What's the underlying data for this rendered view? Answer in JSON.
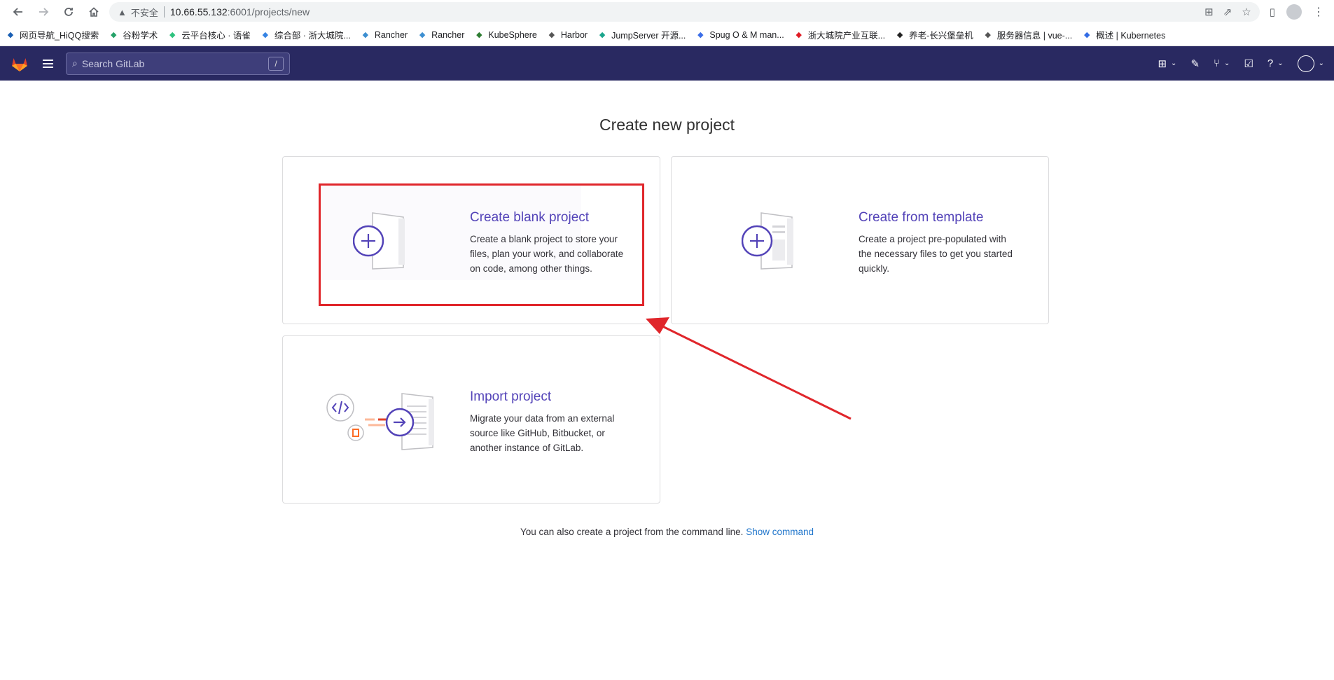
{
  "browser": {
    "security_label": "不安全",
    "url_host": "10.66.55.132",
    "url_path": ":6001/projects/new",
    "bookmarks": [
      {
        "label": "网页导航_HiQQ搜索",
        "color": "#1a5fb4"
      },
      {
        "label": "谷粉学术",
        "color": "#26a269"
      },
      {
        "label": "云平台核心 · 语雀",
        "color": "#2ec27e"
      },
      {
        "label": "综合部 · 浙大城院...",
        "color": "#3584e4"
      },
      {
        "label": "Rancher",
        "color": "#3d8fd1"
      },
      {
        "label": "Rancher",
        "color": "#3d8fd1"
      },
      {
        "label": "KubeSphere",
        "color": "#2e7d32"
      },
      {
        "label": "Harbor",
        "color": "#555"
      },
      {
        "label": "JumpServer 开源...",
        "color": "#1aa58c"
      },
      {
        "label": "Spug O & M man...",
        "color": "#3b6ee8"
      },
      {
        "label": "浙大城院产业互联...",
        "color": "#e01b24"
      },
      {
        "label": "养老-长兴堡垒机",
        "color": "#222"
      },
      {
        "label": "服务器信息 | vue-...",
        "color": "#555"
      },
      {
        "label": "概述 | Kubernetes",
        "color": "#326ce5"
      }
    ]
  },
  "gitlab": {
    "search_placeholder": "Search GitLab",
    "search_shortcut": "/"
  },
  "page": {
    "title": "Create new project",
    "cards": [
      {
        "title": "Create blank project",
        "lines": [
          "Create a blank project to store your",
          "files, plan your work, and collaborate",
          "on code, among other things."
        ]
      },
      {
        "title": "Create from template",
        "lines": [
          "Create a project pre-populated with",
          "the necessary files to get you started",
          "quickly."
        ]
      },
      {
        "title": "Import project",
        "lines": [
          "Migrate your data from an external",
          "source like GitHub, Bitbucket, or",
          "another instance of GitLab."
        ]
      }
    ],
    "footer_text": "You can also create a project from the command line.",
    "footer_link": "Show command"
  },
  "colors": {
    "accent": "#5343b8",
    "header": "#292961",
    "annotation": "#e0262b",
    "link": "#1f75cb"
  }
}
